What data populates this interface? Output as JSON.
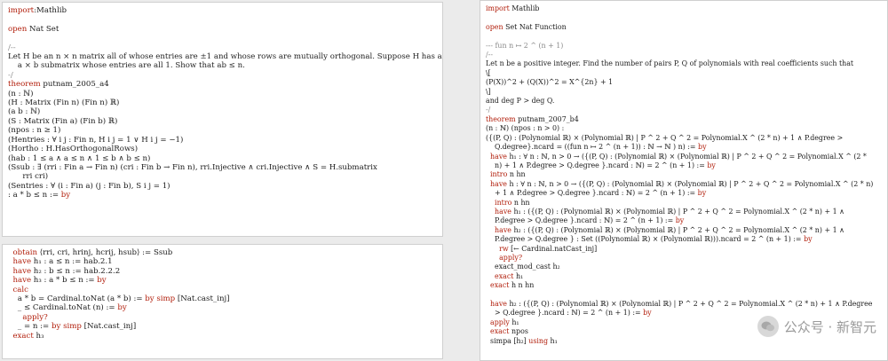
{
  "left_top": [
    [
      [
        "kw",
        "import"
      ],
      [
        "",
        ":Mathlib"
      ]
    ],
    [],
    [
      [
        "kw",
        "open"
      ],
      [
        "",
        " Nat Set"
      ]
    ],
    [],
    [
      [
        "cm",
        "/--"
      ]
    ],
    [
      [
        "tx",
        "Let H be an n × n matrix all of whose entries are ±1 and whose rows are mutually orthogonal. Suppose H has an"
      ]
    ],
    [
      [
        "tx",
        "    a × b submatrix whose entries are all 1. Show that ab ≤ n."
      ]
    ],
    [
      [
        "cm",
        "-/"
      ]
    ],
    [
      [
        "kw",
        "theorem"
      ],
      [
        "",
        " putnam_2005_a4"
      ]
    ],
    [
      [
        "",
        "(n : ℕ)"
      ]
    ],
    [
      [
        "",
        "(H : Matrix (Fin n) (Fin n) ℝ)"
      ]
    ],
    [
      [
        "",
        "(a b : ℕ)"
      ]
    ],
    [
      [
        "",
        "(S : Matrix (Fin a) (Fin b) ℝ)"
      ]
    ],
    [
      [
        "",
        "(npos : n ≥ 1)"
      ]
    ],
    [
      [
        "",
        "(Hentries : ∀ i j : Fin n, H i j = 1 ∨ H i j = −1)"
      ]
    ],
    [
      [
        "",
        "(Hortho : H.HasOrthogonalRows)"
      ]
    ],
    [
      [
        "",
        "(hab : 1 ≤ a ∧ a ≤ n ∧ 1 ≤ b ∧ b ≤ n)"
      ]
    ],
    [
      [
        "",
        "(Ssub : ∃ (rri : Fin a → Fin n) (cri : Fin b → Fin n), rri.Injective ∧ cri.Injective ∧ S = H.submatrix"
      ]
    ],
    [
      [
        "",
        "      rri cri)"
      ]
    ],
    [
      [
        "",
        "(Sentries : ∀ (i : Fin a) (j : Fin b), S i j = 1)"
      ]
    ],
    [
      [
        "",
        ": a * b ≤ n := "
      ],
      [
        "kw",
        "by"
      ]
    ]
  ],
  "left_bottom": [
    [
      [
        "",
        "  "
      ],
      [
        "kw",
        "obtain"
      ],
      [
        "",
        " ⟨rri, cri, hrinj, hcrij, hsub⟩ := Ssub"
      ]
    ],
    [
      [
        "",
        "  "
      ],
      [
        "kw",
        "have"
      ],
      [
        "",
        " h₁ : a ≤ n := hab.2.1"
      ]
    ],
    [
      [
        "",
        "  "
      ],
      [
        "kw",
        "have"
      ],
      [
        "",
        " h₂ : b ≤ n := hab.2.2.2"
      ]
    ],
    [
      [
        "",
        "  "
      ],
      [
        "kw",
        "have"
      ],
      [
        "",
        " h₃ : a * b ≤ n := "
      ],
      [
        "kw",
        "by"
      ]
    ],
    [
      [
        "",
        "  "
      ],
      [
        "kw",
        "calc"
      ]
    ],
    [
      [
        "",
        "    a * b = Cardinal.toNat (a * b) := "
      ],
      [
        "kw",
        "by"
      ],
      [
        "",
        " "
      ],
      [
        "kw",
        "simp"
      ],
      [
        "",
        " [Nat.cast_inj]"
      ]
    ],
    [
      [
        "",
        "    _ ≤ Cardinal.toNat (n) := "
      ],
      [
        "kw",
        "by"
      ]
    ],
    [
      [
        "",
        "      "
      ],
      [
        "kw",
        "apply?"
      ]
    ],
    [
      [
        "",
        "    _ = n := "
      ],
      [
        "kw",
        "by"
      ],
      [
        "",
        " "
      ],
      [
        "kw",
        "simp"
      ],
      [
        "",
        " [Nat.cast_inj]"
      ]
    ],
    [
      [
        "",
        "  "
      ],
      [
        "kw",
        "exact"
      ],
      [
        "",
        " h₃"
      ]
    ]
  ],
  "right": [
    [
      [
        "kw",
        "import"
      ],
      [
        "",
        " Mathlib"
      ]
    ],
    [],
    [
      [
        "kw",
        "open"
      ],
      [
        "",
        " Set Nat Function"
      ]
    ],
    [],
    [
      [
        "cm",
        "--- fun n ↦ 2 ^ (n + 1)"
      ]
    ],
    [
      [
        "cm",
        "/--"
      ]
    ],
    [
      [
        "tx",
        "Let n be a positive integer. Find the number of pairs P, Q of polynomials with real coefficients such that"
      ]
    ],
    [
      [
        "",
        "\\["
      ]
    ],
    [
      [
        "",
        "(P(X))^2 + (Q(X))^2 = X^{2n} + 1"
      ]
    ],
    [
      [
        "",
        "\\]"
      ]
    ],
    [
      [
        "tx",
        "and deg P > deg Q."
      ]
    ],
    [
      [
        "cm",
        "-/"
      ]
    ],
    [
      [
        "kw",
        "theorem"
      ],
      [
        "",
        " putnam_2007_b4"
      ]
    ],
    [
      [
        "",
        "(n : ℕ) (npos : n > 0) :"
      ]
    ],
    [
      [
        "",
        "({(P, Q) : (Polynomial ℝ) × (Polynomial ℝ) | P ^ 2 + Q ^ 2 = Polynomial.X ^ (2 * n) + 1 ∧ P.degree >"
      ]
    ],
    [
      [
        "",
        "    Q.degree}.ncard = ((fun n ↦ 2 ^ (n + 1)) : ℕ → ℕ ) n) := "
      ],
      [
        "kw",
        "by"
      ]
    ],
    [
      [
        "",
        "  "
      ],
      [
        "kw",
        "have"
      ],
      [
        "",
        " h₁ : ∀ n : ℕ, n > 0 → ({(P, Q) : (Polynomial ℝ) × (Polynomial ℝ) | P ^ 2 + Q ^ 2 = Polynomial.X ^ (2 *"
      ]
    ],
    [
      [
        "",
        "    n) + 1 ∧ P.degree > Q.degree }.ncard : ℕ) = 2 ^ (n + 1) := "
      ],
      [
        "kw",
        "by"
      ]
    ],
    [
      [
        "",
        "  "
      ],
      [
        "kw",
        "intro"
      ],
      [
        "",
        " n hn"
      ]
    ],
    [
      [
        "",
        "  "
      ],
      [
        "kw",
        "have"
      ],
      [
        "",
        " h : ∀ n : ℕ, n > 0 → ({(P, Q) : (Polynomial ℝ) × (Polynomial ℝ) | P ^ 2 + Q ^ 2 = Polynomial.X ^ (2 * n)"
      ]
    ],
    [
      [
        "",
        "    + 1 ∧ P.degree > Q.degree }.ncard : ℕ) = 2 ^ (n + 1) := "
      ],
      [
        "kw",
        "by"
      ]
    ],
    [
      [
        "",
        "    "
      ],
      [
        "kw",
        "intro"
      ],
      [
        "",
        " n hn"
      ]
    ],
    [
      [
        "",
        "    "
      ],
      [
        "kw",
        "have"
      ],
      [
        "",
        " h₁ : ({(P, Q) : (Polynomial ℝ) × (Polynomial ℝ) | P ^ 2 + Q ^ 2 = Polynomial.X ^ (2 * n) + 1 ∧"
      ]
    ],
    [
      [
        "",
        "    P.degree > Q.degree }.ncard : ℕ) = 2 ^ (n + 1) := "
      ],
      [
        "kw",
        "by"
      ]
    ],
    [
      [
        "",
        "    "
      ],
      [
        "kw",
        "have"
      ],
      [
        "",
        " h₂ : ({(P, Q) : (Polynomial ℝ) × (Polynomial ℝ) | P ^ 2 + Q ^ 2 = Polynomial.X ^ (2 * n) + 1 ∧"
      ]
    ],
    [
      [
        "",
        "    P.degree > Q.degree } : Set ((Polynomial ℝ) × (Polynomial ℝ))).ncard = 2 ^ (n + 1) := "
      ],
      [
        "kw",
        "by"
      ]
    ],
    [
      [
        "",
        "      "
      ],
      [
        "kw",
        "rw"
      ],
      [
        "",
        " [← Cardinal.natCast_inj]"
      ]
    ],
    [
      [
        "",
        "      "
      ],
      [
        "kw",
        "apply?"
      ]
    ],
    [
      [
        "",
        "    exact_mod_cast h₂"
      ]
    ],
    [
      [
        "",
        "    "
      ],
      [
        "kw",
        "exact"
      ],
      [
        "",
        " h₁"
      ]
    ],
    [
      [
        "",
        "  "
      ],
      [
        "kw",
        "exact"
      ],
      [
        "",
        " h n hn"
      ]
    ],
    [],
    [
      [
        "",
        "  "
      ],
      [
        "kw",
        "have"
      ],
      [
        "",
        " h₂ : ({(P, Q) : (Polynomial ℝ) × (Polynomial ℝ) | P ^ 2 + Q ^ 2 = Polynomial.X ^ (2 * n) + 1 ∧ P.degree"
      ]
    ],
    [
      [
        "",
        "    > Q.degree }.ncard : ℕ) = 2 ^ (n + 1) := "
      ],
      [
        "kw",
        "by"
      ]
    ],
    [
      [
        "",
        "  "
      ],
      [
        "kw",
        "apply"
      ],
      [
        "",
        " h₁"
      ]
    ],
    [
      [
        "",
        "  "
      ],
      [
        "kw",
        "exact"
      ],
      [
        "",
        " npos"
      ]
    ],
    [
      [
        "",
        "  simpa [h₂] "
      ],
      [
        "kw",
        "using"
      ],
      [
        "",
        " h₁"
      ]
    ]
  ],
  "watermark": "公众号 · 新智元"
}
